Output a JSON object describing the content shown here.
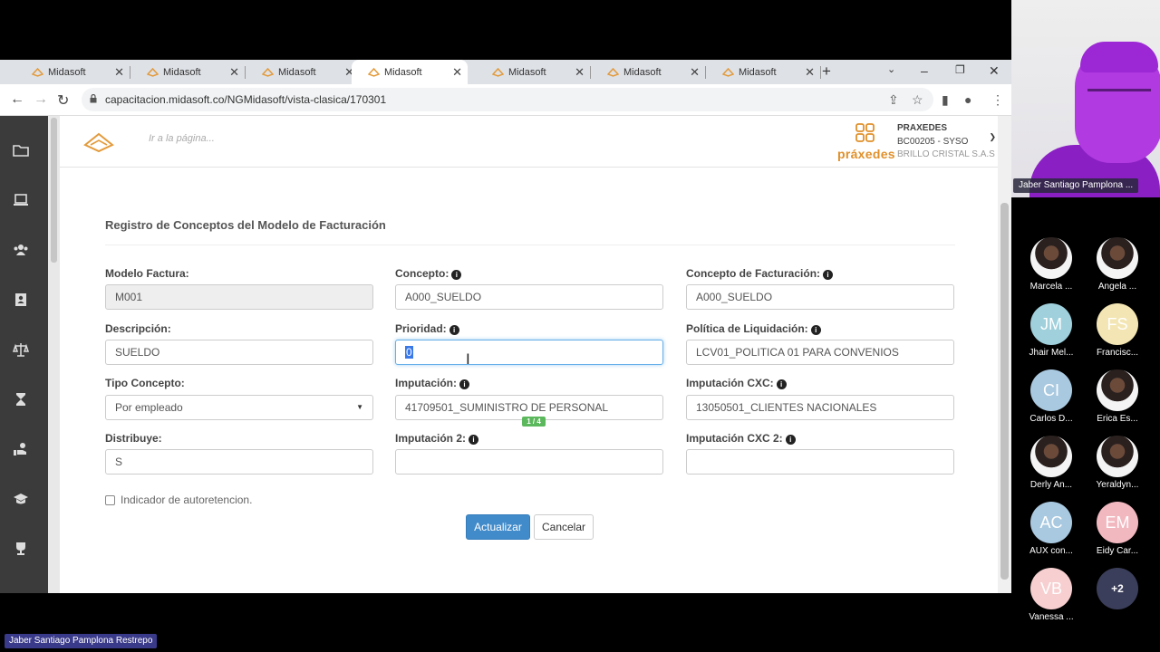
{
  "browser": {
    "tabs": [
      {
        "title": "Midasoft",
        "active": false
      },
      {
        "title": "Midasoft",
        "active": false
      },
      {
        "title": "Midasoft",
        "active": false
      },
      {
        "title": "Midasoft",
        "active": true
      },
      {
        "title": "Midasoft",
        "active": false
      },
      {
        "title": "Midasoft",
        "active": false
      },
      {
        "title": "Midasoft",
        "active": false
      }
    ],
    "url": "capacitacion.midasoft.co/NGMidasoft/vista-clasica/170301"
  },
  "header": {
    "search_placeholder": "Ir a la página...",
    "brand_name": "práxedes",
    "user_line1": "PRAXEDES",
    "user_line2": "BC00205 - SYSO",
    "user_line3": "BRILLO CRISTAL S.A.S"
  },
  "form": {
    "title": "Registro de Conceptos del Modelo de Facturación",
    "modelo_factura": {
      "label": "Modelo Factura:",
      "value": "M001"
    },
    "concepto": {
      "label": "Concepto:",
      "value": "A000_SUELDO"
    },
    "concepto_facturacion": {
      "label": "Concepto de Facturación:",
      "value": "A000_SUELDO"
    },
    "descripcion": {
      "label": "Descripción:",
      "value": "SUELDO"
    },
    "prioridad": {
      "label": "Prioridad:",
      "value": "0"
    },
    "politica_liquidacion": {
      "label": "Política de Liquidación:",
      "value": "LCV01_POLITICA 01 PARA CONVENIOS"
    },
    "tipo_concepto": {
      "label": "Tipo Concepto:",
      "value": "Por empleado"
    },
    "imputacion": {
      "label": "Imputación:",
      "value": "41709501_SUMINISTRO DE PERSONAL"
    },
    "imputacion_cxc": {
      "label": "Imputación CXC:",
      "value": "13050501_CLIENTES NACIONALES"
    },
    "distribuye": {
      "label": "Distribuye:",
      "value": "S"
    },
    "imputacion_2": {
      "label": "Imputación 2:",
      "value": ""
    },
    "imputacion_cxc_2": {
      "label": "Imputación CXC 2:",
      "value": ""
    },
    "pager": "1 / 4",
    "autoretencion_label": "Indicador de autoretencion.",
    "update_label": "Actualizar",
    "cancel_label": "Cancelar"
  },
  "meeting": {
    "speaker": "Jaber Santiago Pamplona ...",
    "presenter": "Jaber Santiago Pamplona Restrepo",
    "participants": [
      {
        "name": "Marcela ...",
        "initials": "",
        "color": ""
      },
      {
        "name": "Angela ...",
        "initials": "",
        "color": ""
      },
      {
        "name": "Jhair Mel...",
        "initials": "JM",
        "color": "#9fd0dc"
      },
      {
        "name": "Francisc...",
        "initials": "FS",
        "color": "#f3e6b4"
      },
      {
        "name": "Carlos D...",
        "initials": "CI",
        "color": "#a9c9e0"
      },
      {
        "name": "Erica Es...",
        "initials": "",
        "color": ""
      },
      {
        "name": "Derly An...",
        "initials": "",
        "color": ""
      },
      {
        "name": "Yeraldyn...",
        "initials": "",
        "color": ""
      },
      {
        "name": "AUX con...",
        "initials": "AC",
        "color": "#a9c9e0"
      },
      {
        "name": "Eidy Car...",
        "initials": "EM",
        "color": "#f2b8c0"
      },
      {
        "name": "Vanessa ...",
        "initials": "VB",
        "color": "#f7cfd0"
      }
    ],
    "more_label": "+2"
  }
}
